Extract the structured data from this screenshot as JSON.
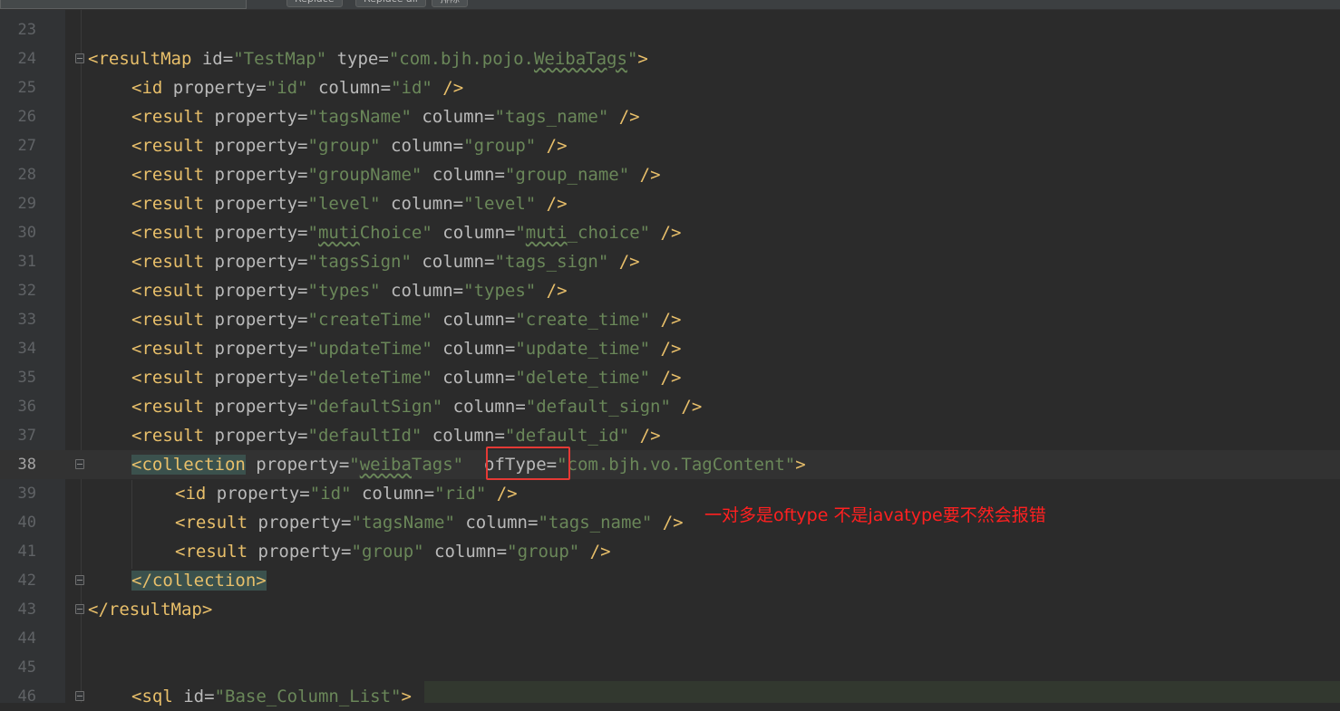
{
  "toolbar": {
    "replace_label": "Replace",
    "replace_all_label": "Replace all",
    "exclude_label": "排除"
  },
  "editor": {
    "current_line": "38",
    "lines": [
      {
        "num": "23"
      },
      {
        "num": "24",
        "open": "<",
        "tag": "resultMap",
        "a1": "id",
        "v1": "\"TestMap\"",
        "a2": "type",
        "v2a": "\"com.bjh.pojo.",
        "v2b": "WeibaTags",
        "v2c": "\"",
        "close": ">"
      },
      {
        "num": "25",
        "tag": "<id",
        "a1": "property",
        "v1": "\"id\"",
        "a2": "column",
        "v2": "\"id\"",
        "close": "/>"
      },
      {
        "num": "26",
        "tag": "<result",
        "a1": "property",
        "v1": "\"tagsName\"",
        "a2": "column",
        "v2": "\"tags_name\"",
        "close": "/>"
      },
      {
        "num": "27",
        "tag": "<result",
        "a1": "property",
        "v1": "\"group\"",
        "a2": "column",
        "v2": "\"group\"",
        "close": "/>"
      },
      {
        "num": "28",
        "tag": "<result",
        "a1": "property",
        "v1": "\"groupName\"",
        "a2": "column",
        "v2": "\"group_name\"",
        "close": "/>"
      },
      {
        "num": "29",
        "tag": "<result",
        "a1": "property",
        "v1": "\"level\"",
        "a2": "column",
        "v2": "\"level\"",
        "close": "/>"
      },
      {
        "num": "30",
        "tag": "<result",
        "a1": "property",
        "v1a": "\"",
        "v1b": "muti",
        "v1c": "Choice\"",
        "a2": "column",
        "v2a": "\"",
        "v2b": "muti",
        "v2c": "_choice\"",
        "close": "/>"
      },
      {
        "num": "31",
        "tag": "<result",
        "a1": "property",
        "v1": "\"tagsSign\"",
        "a2": "column",
        "v2": "\"tags_sign\"",
        "close": "/>"
      },
      {
        "num": "32",
        "tag": "<result",
        "a1": "property",
        "v1": "\"types\"",
        "a2": "column",
        "v2": "\"types\"",
        "close": "/>"
      },
      {
        "num": "33",
        "tag": "<result",
        "a1": "property",
        "v1": "\"createTime\"",
        "a2": "column",
        "v2": "\"create_time\"",
        "close": "/>"
      },
      {
        "num": "34",
        "tag": "<result",
        "a1": "property",
        "v1": "\"updateTime\"",
        "a2": "column",
        "v2": "\"update_time\"",
        "close": "/>"
      },
      {
        "num": "35",
        "tag": "<result",
        "a1": "property",
        "v1": "\"deleteTime\"",
        "a2": "column",
        "v2": "\"delete_time\"",
        "close": "/>"
      },
      {
        "num": "36",
        "tag": "<result",
        "a1": "property",
        "v1": "\"defaultSign\"",
        "a2": "column",
        "v2": "\"default_sign\"",
        "close": "/>"
      },
      {
        "num": "37",
        "tag": "<result",
        "a1": "property",
        "v1": "\"defaultId\"",
        "a2": "column",
        "v2": "\"default_id\"",
        "close": "/>"
      },
      {
        "num": "38",
        "tag": "<collection",
        "a1": "property",
        "v1a": "\"",
        "v1b": "weiba",
        "v1c": "Tags\"",
        "a2": "ofType",
        "v2": "\"com.bjh.vo.TagContent\"",
        "close": ">"
      },
      {
        "num": "39",
        "tag": "<id",
        "a1": "property",
        "v1": "\"id\"",
        "a2": "column",
        "v2": "\"rid\"",
        "close": "/>"
      },
      {
        "num": "40",
        "tag": "<result",
        "a1": "property",
        "v1": "\"tagsName\"",
        "a2": "column",
        "v2": "\"tags_name\"",
        "close": "/>"
      },
      {
        "num": "41",
        "tag": "<result",
        "a1": "property",
        "v1": "\"group\"",
        "a2": "column",
        "v2": "\"group\"",
        "close": "/>"
      },
      {
        "num": "42",
        "tag": "</collection>"
      },
      {
        "num": "43",
        "tag": "</resultMap>"
      },
      {
        "num": "44"
      },
      {
        "num": "45"
      },
      {
        "num": "46",
        "tag": "<sql",
        "a1": "id",
        "v1": "\"Base_Column_List\"",
        "close": ">"
      }
    ]
  },
  "annotation": {
    "text": "一对多是oftype  不是javatype要不然会报错",
    "color": "#ff2020"
  },
  "colors": {
    "background": "#2b2b2b",
    "tag": "#e8bf6a",
    "attribute": "#bababa",
    "value": "#6a8759",
    "line_number": "#606366",
    "highlight_box": "#e53935"
  }
}
